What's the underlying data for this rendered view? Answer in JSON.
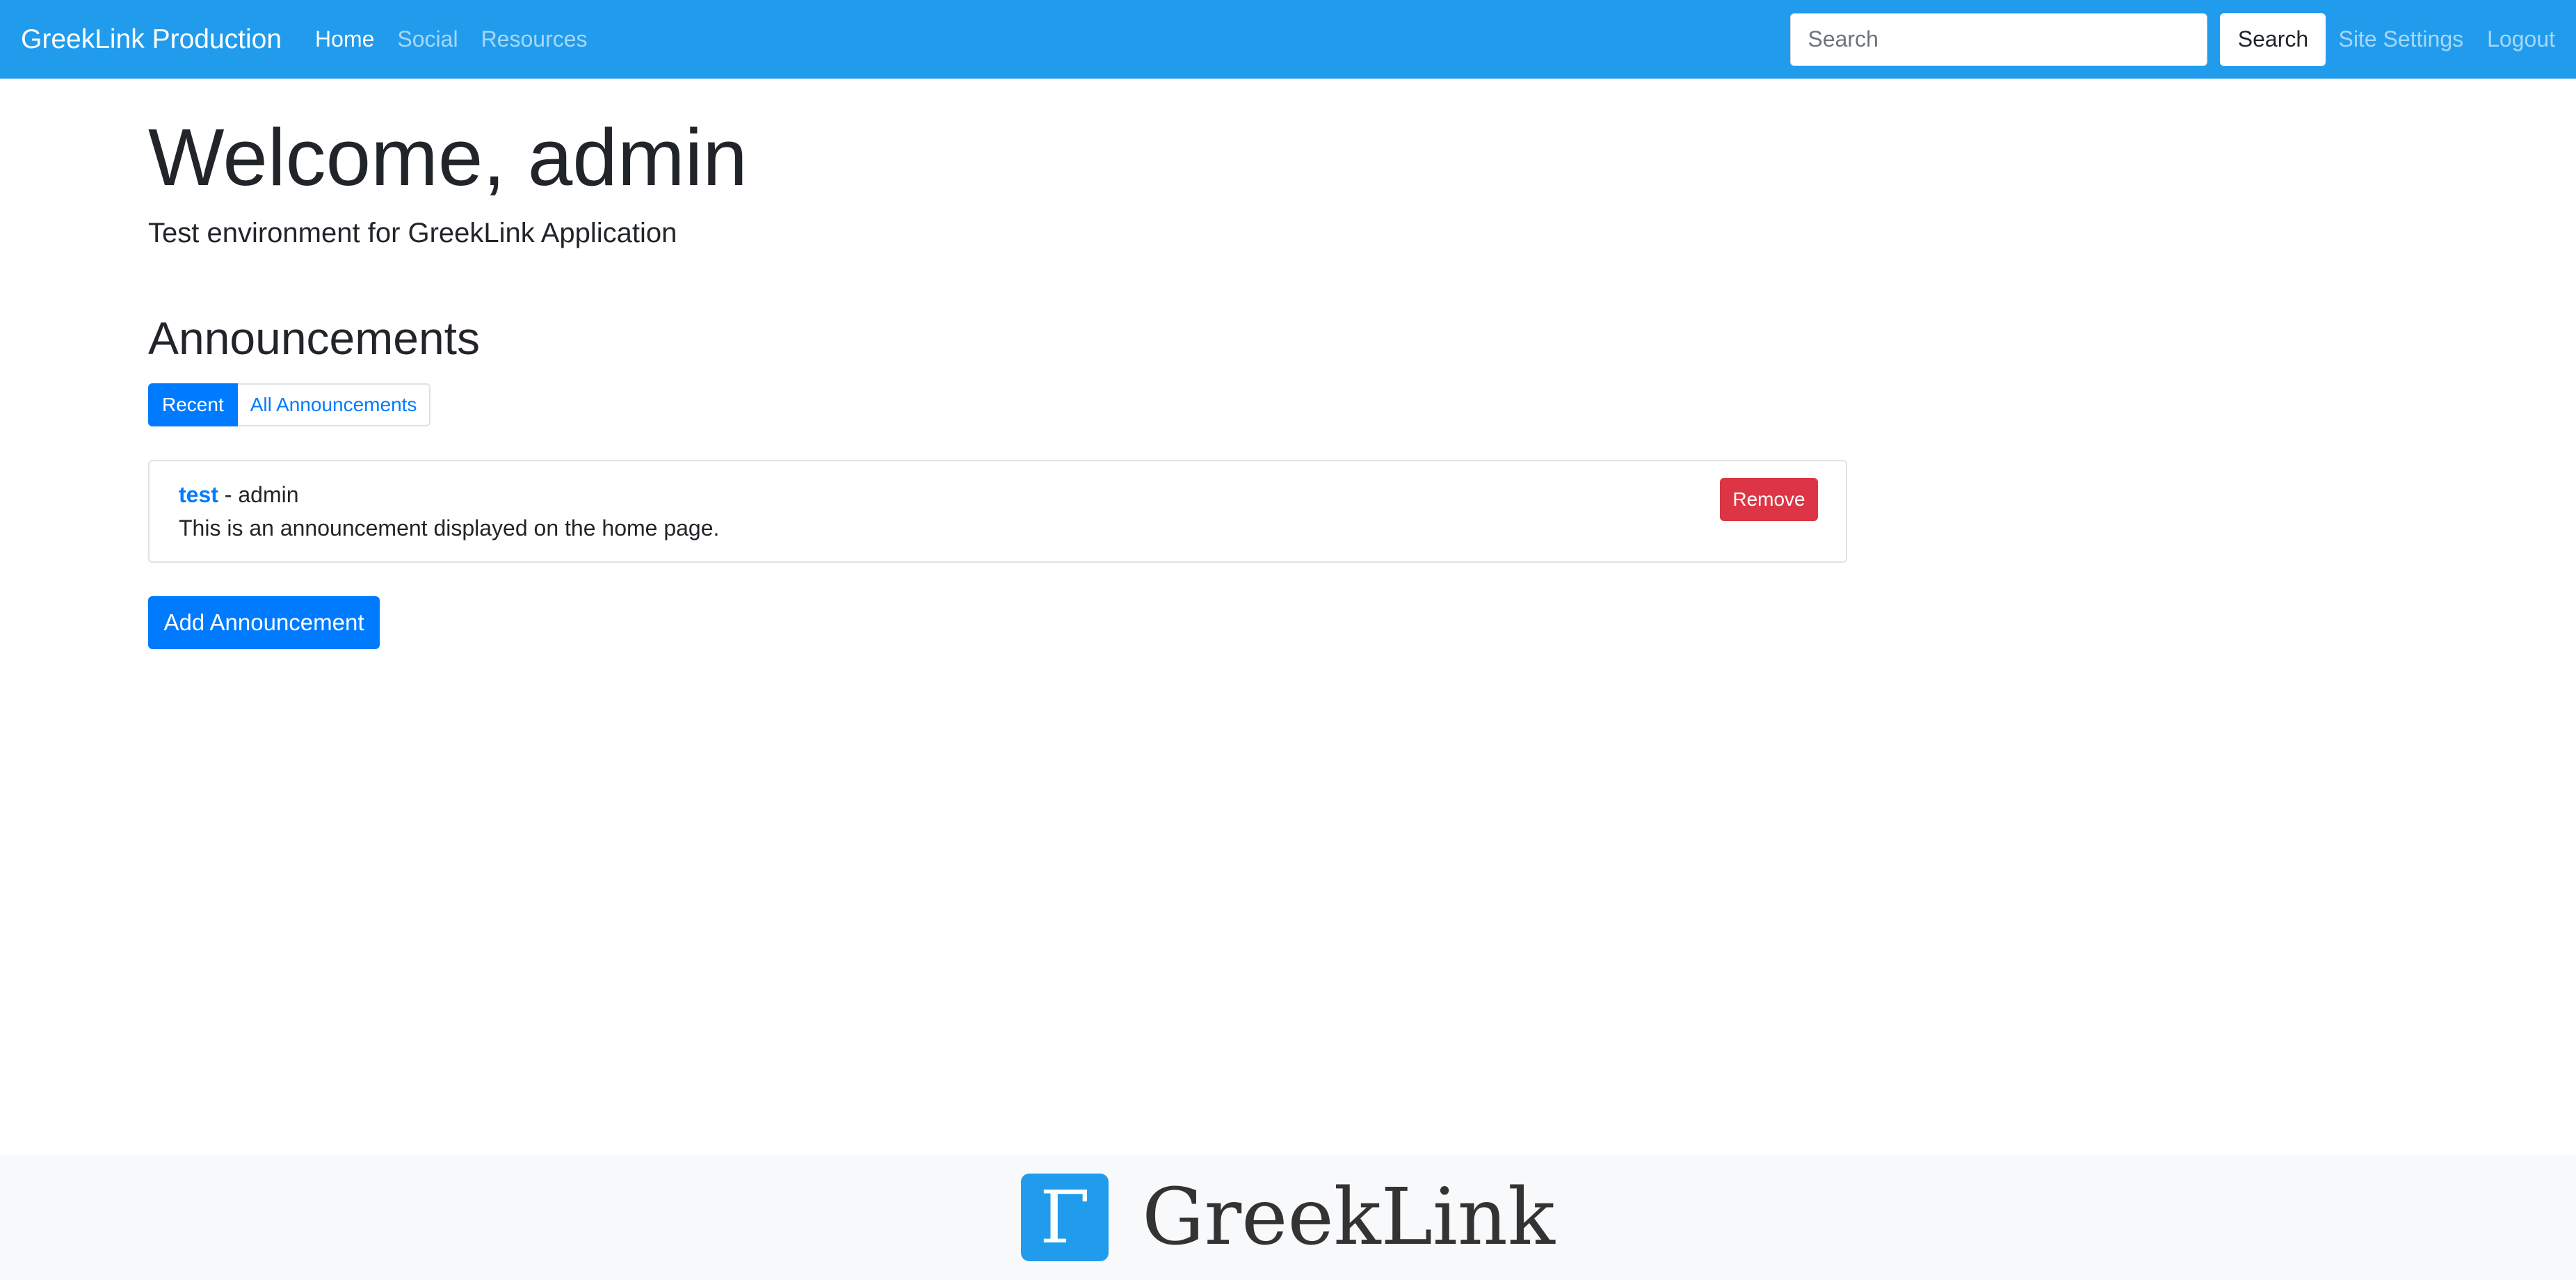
{
  "navbar": {
    "brand": "GreekLink Production",
    "links": [
      {
        "label": "Home",
        "active": true
      },
      {
        "label": "Social",
        "active": false
      },
      {
        "label": "Resources",
        "active": false
      }
    ],
    "search_placeholder": "Search",
    "search_value": "",
    "search_button": "Search",
    "site_settings": "Site Settings",
    "logout": "Logout"
  },
  "main": {
    "welcome": "Welcome, admin",
    "subtitle": "Test environment for GreekLink Application",
    "announcements_heading": "Announcements",
    "tabs": [
      {
        "label": "Recent",
        "active": true
      },
      {
        "label": "All Announcements",
        "active": false
      }
    ],
    "announcement": {
      "title": "test",
      "author_suffix": " - admin",
      "body": "This is an announcement displayed on the home page.",
      "remove_label": "Remove"
    },
    "add_button": "Add Announcement"
  },
  "footer": {
    "logo_glyph": "Γ",
    "logo_text": "GreekLink"
  },
  "colors": {
    "navbar": "#219ced",
    "primary": "#007bff",
    "danger": "#dc3545",
    "footer_bg": "#f8f9fa"
  }
}
